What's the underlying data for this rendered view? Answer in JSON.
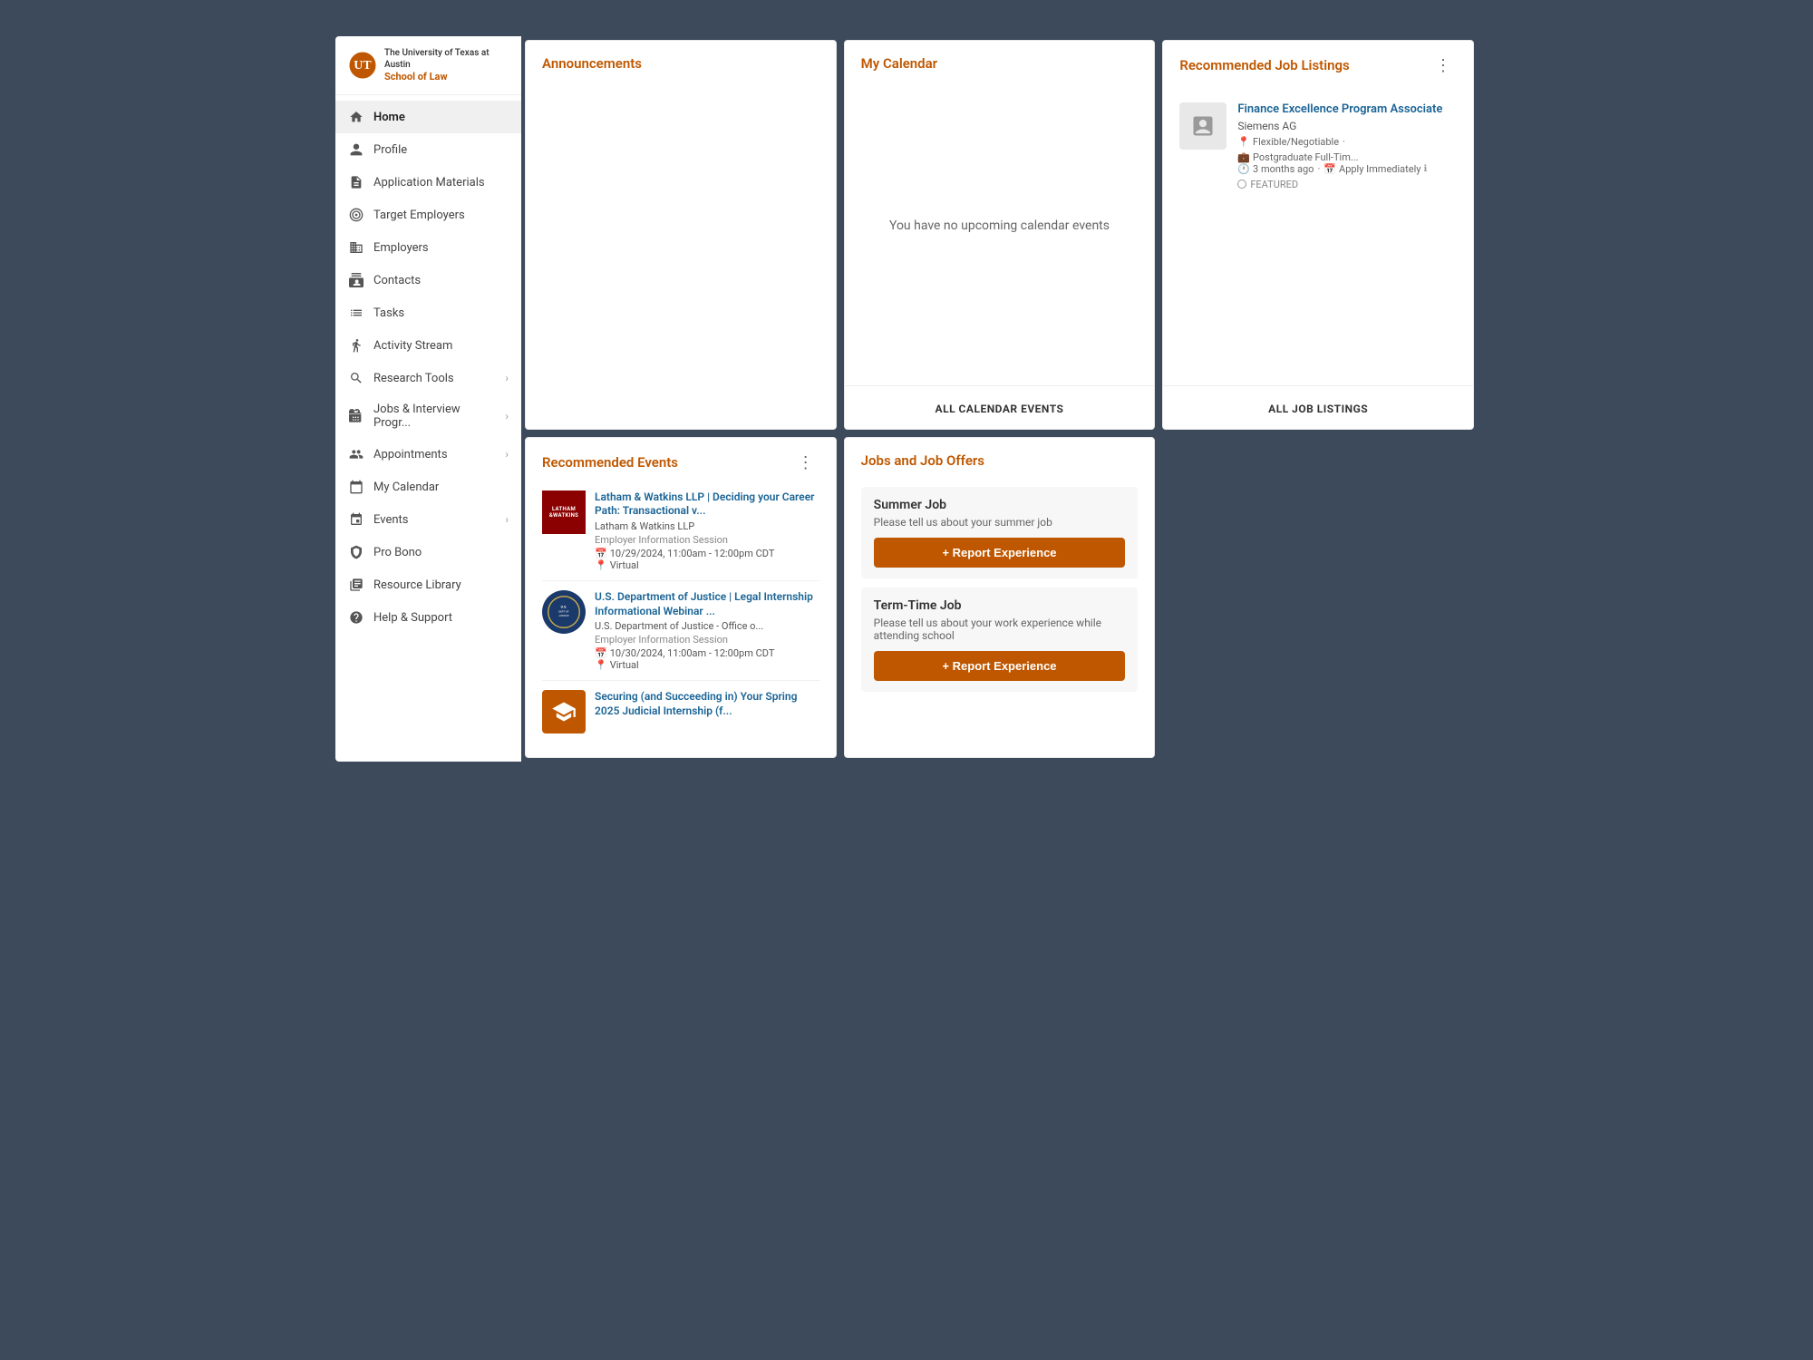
{
  "app": {
    "university_line1": "The University of Texas at Austin",
    "school_name": "School of Law"
  },
  "sidebar": {
    "items": [
      {
        "id": "home",
        "label": "Home",
        "icon": "home",
        "active": true,
        "hasChevron": false
      },
      {
        "id": "profile",
        "label": "Profile",
        "icon": "user",
        "active": false,
        "hasChevron": false
      },
      {
        "id": "application-materials",
        "label": "Application Materials",
        "icon": "file",
        "active": false,
        "hasChevron": false
      },
      {
        "id": "target-employers",
        "label": "Target Employers",
        "icon": "target",
        "active": false,
        "hasChevron": false
      },
      {
        "id": "employers",
        "label": "Employers",
        "icon": "building",
        "active": false,
        "hasChevron": false
      },
      {
        "id": "contacts",
        "label": "Contacts",
        "icon": "contacts",
        "active": false,
        "hasChevron": false
      },
      {
        "id": "tasks",
        "label": "Tasks",
        "icon": "tasks",
        "active": false,
        "hasChevron": false
      },
      {
        "id": "activity-stream",
        "label": "Activity Stream",
        "icon": "activity",
        "active": false,
        "hasChevron": false
      },
      {
        "id": "research-tools",
        "label": "Research Tools",
        "icon": "research",
        "active": false,
        "hasChevron": true
      },
      {
        "id": "jobs-interview",
        "label": "Jobs & Interview Progr...",
        "icon": "jobs",
        "active": false,
        "hasChevron": true
      },
      {
        "id": "appointments",
        "label": "Appointments",
        "icon": "appointment",
        "active": false,
        "hasChevron": true
      },
      {
        "id": "my-calendar",
        "label": "My Calendar",
        "icon": "calendar",
        "active": false,
        "hasChevron": false
      },
      {
        "id": "events",
        "label": "Events",
        "icon": "events",
        "active": false,
        "hasChevron": true
      },
      {
        "id": "pro-bono",
        "label": "Pro Bono",
        "icon": "probono",
        "active": false,
        "hasChevron": false
      },
      {
        "id": "resource-library",
        "label": "Resource Library",
        "icon": "library",
        "active": false,
        "hasChevron": false
      },
      {
        "id": "help-support",
        "label": "Help & Support",
        "icon": "help",
        "active": false,
        "hasChevron": false
      }
    ]
  },
  "announcements": {
    "title": "Announcements",
    "items": []
  },
  "my_calendar": {
    "title": "My Calendar",
    "empty_message": "You have no upcoming calendar events",
    "footer_link": "ALL CALENDAR EVENTS"
  },
  "recommended_job_listings": {
    "title": "Recommended Job Listings",
    "footer_link": "ALL JOB LISTINGS",
    "items": [
      {
        "company": "Siemens AG",
        "title": "Finance Excellence Program Associate",
        "location": "Flexible/Negotiable",
        "employment_type": "Postgraduate Full-Tim...",
        "posted": "3 months ago",
        "apply_text": "Apply Immediately",
        "featured": true,
        "featured_text": "FEATURED"
      }
    ]
  },
  "recommended_events": {
    "title": "Recommended Events",
    "items": [
      {
        "id": "event-1",
        "org": "Latham & Watkins LLP",
        "title": "Latham & Watkins LLP | Deciding your Career Path: Transactional v...",
        "type": "Employer Information Session",
        "date": "10/29/2024, 11:00am - 12:00pm CDT",
        "location": "Virtual",
        "logo_type": "latham",
        "logo_text": "LATHAM&WATKINS"
      },
      {
        "id": "event-2",
        "org": "U.S. Department of Justice - Office o...",
        "title": "U.S. Department of Justice | Legal Internship Informational Webinar ...",
        "type": "Employer Information Session",
        "date": "10/30/2024, 11:00am - 12:00pm CDT",
        "location": "Virtual",
        "logo_type": "doj"
      },
      {
        "id": "event-3",
        "org": "",
        "title": "Securing (and Succeeding in) Your Spring 2025 Judicial Internship (f...",
        "type": "",
        "date": "",
        "location": "",
        "logo_type": "orange"
      }
    ]
  },
  "jobs_and_offers": {
    "title": "Jobs and Job Offers",
    "sections": [
      {
        "id": "summer-job",
        "title": "Summer Job",
        "description": "Please tell us about your summer job",
        "button_label": "+ Report Experience"
      },
      {
        "id": "term-time-job",
        "title": "Term-Time Job",
        "description": "Please tell us about your work experience while attending school",
        "button_label": "+ Report Experience"
      }
    ]
  }
}
